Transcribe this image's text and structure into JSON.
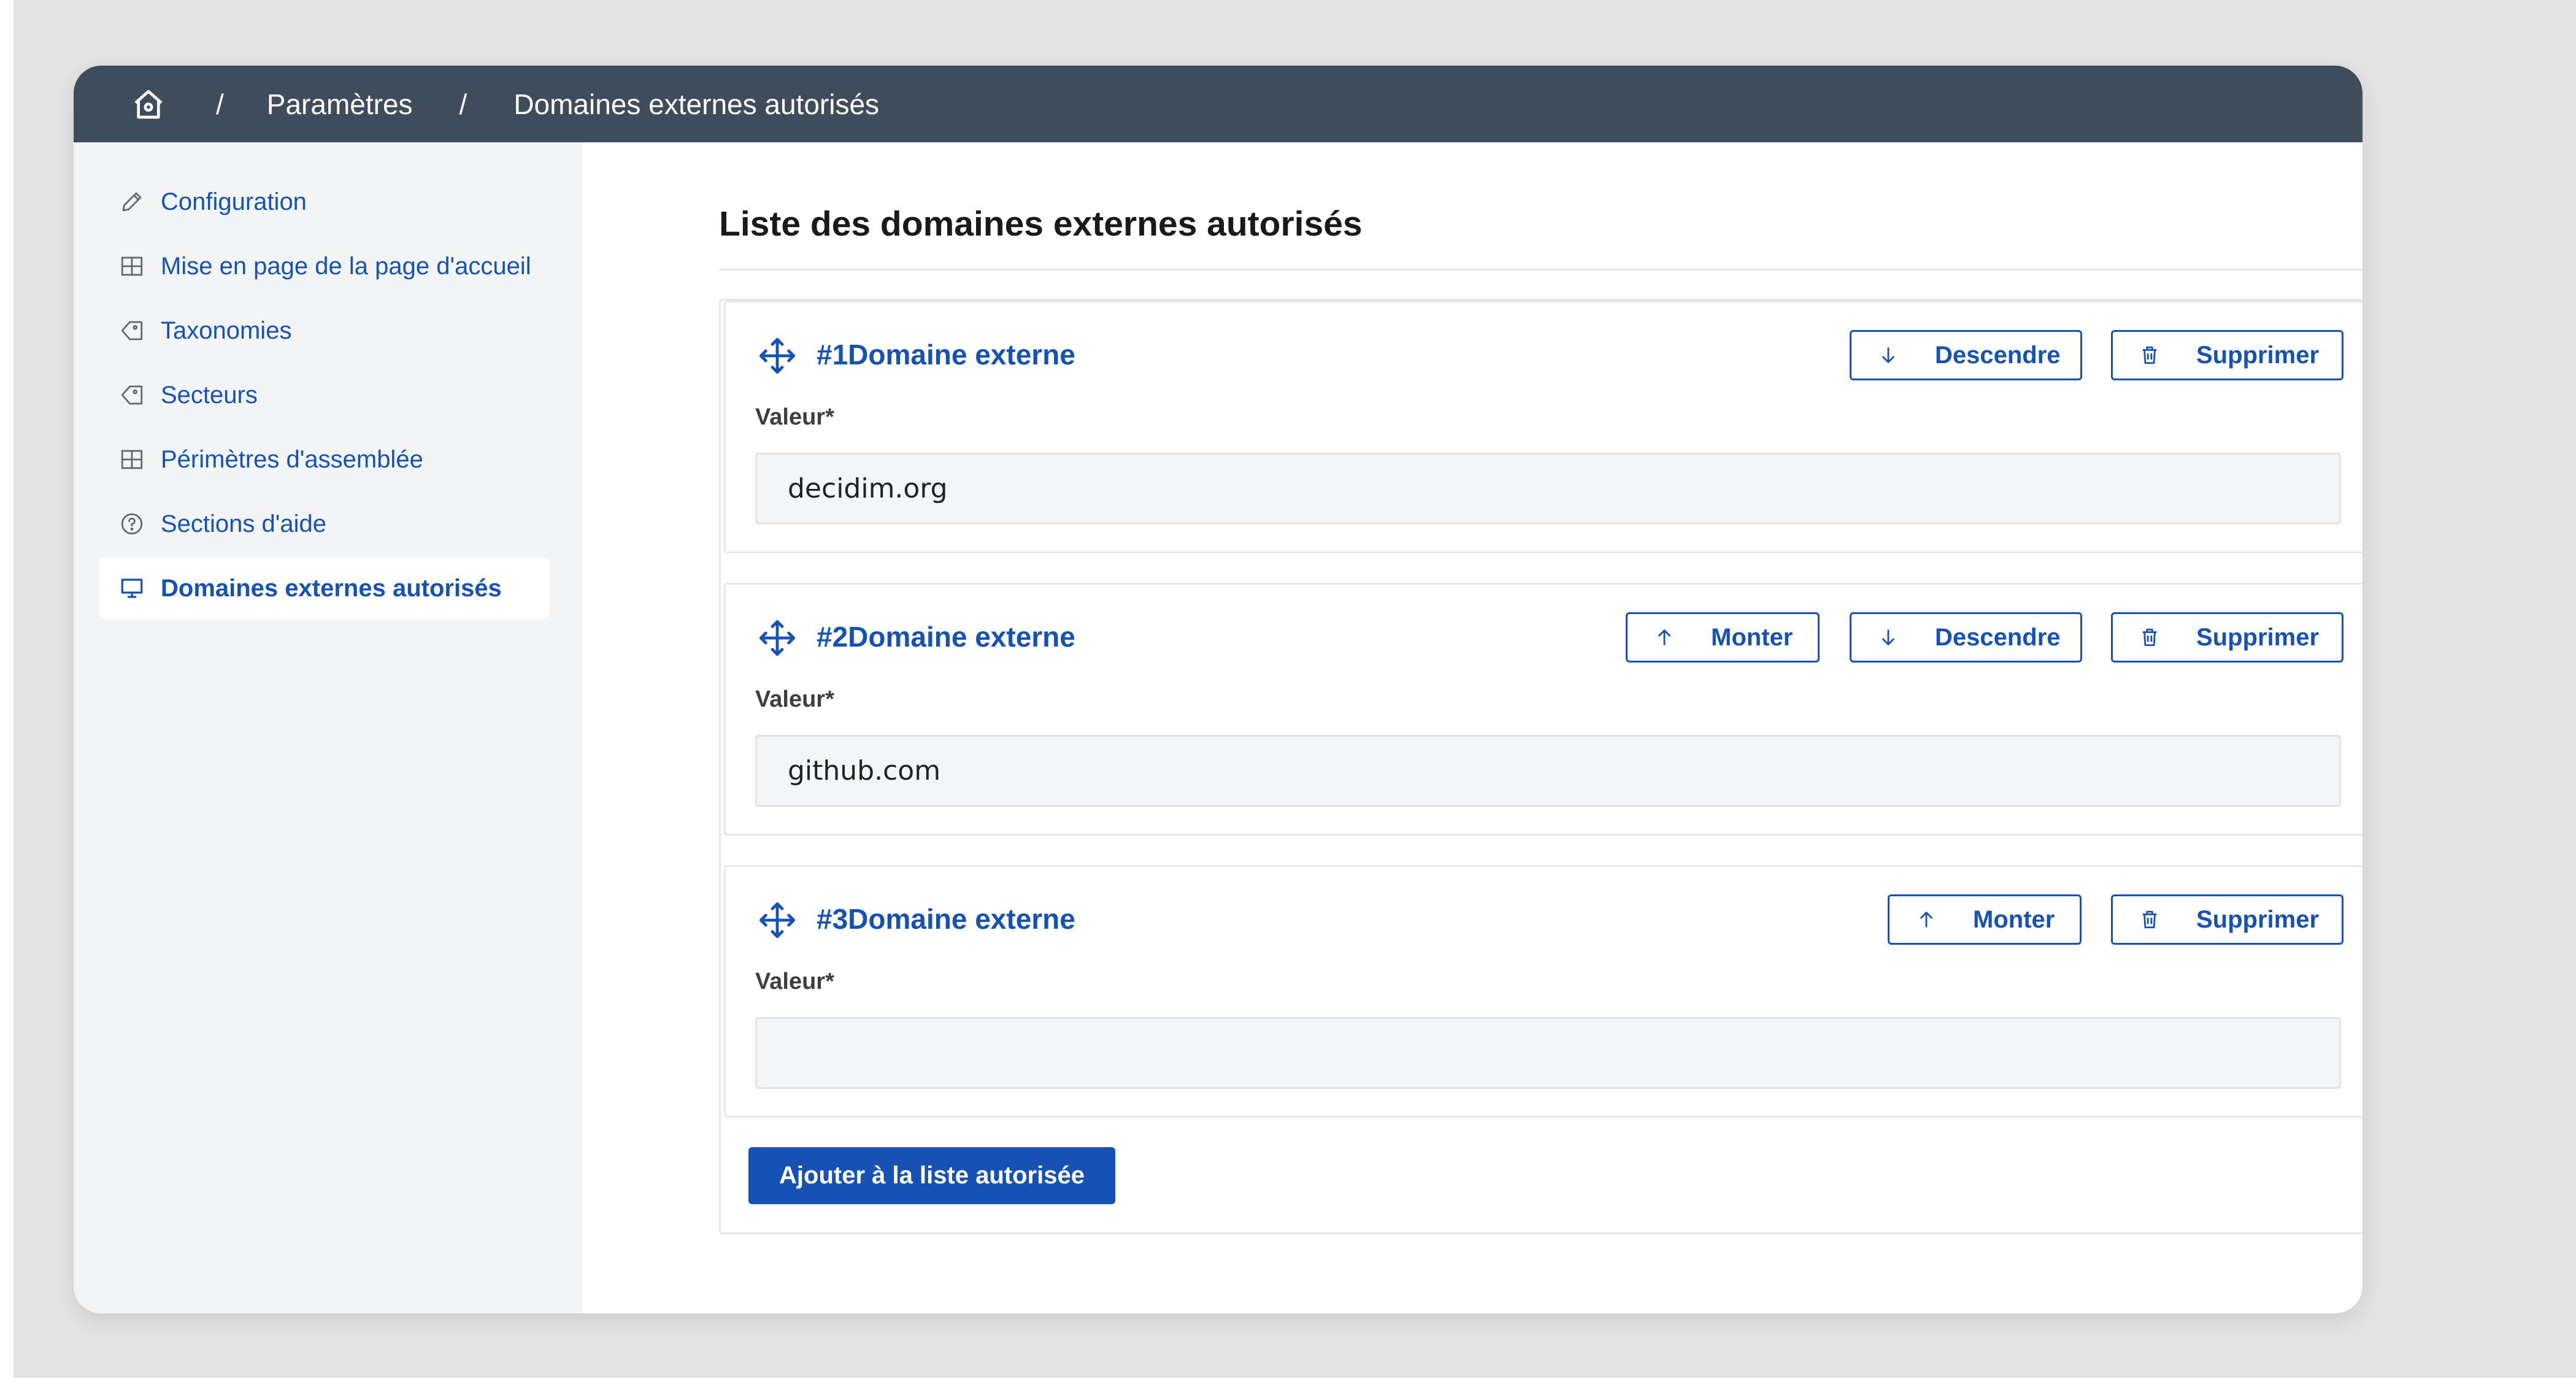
{
  "breadcrumb": {
    "home_icon": "home-icon",
    "separator": "/",
    "items": [
      "Paramètres",
      "Domaines externes autorisés"
    ]
  },
  "sidebar": {
    "items": [
      {
        "label": "Configuration",
        "icon": "pencil-icon",
        "active": false
      },
      {
        "label": "Mise en page de la page d'accueil",
        "icon": "layout-grid-icon",
        "active": false
      },
      {
        "label": "Taxonomies",
        "icon": "tag-icon",
        "active": false
      },
      {
        "label": "Secteurs",
        "icon": "tag-icon",
        "active": false
      },
      {
        "label": "Périmètres d'assemblée",
        "icon": "layout-grid-icon",
        "active": false
      },
      {
        "label": "Sections d'aide",
        "icon": "question-circle-icon",
        "active": false
      },
      {
        "label": "Domaines externes autorisés",
        "icon": "monitor-icon",
        "active": true
      }
    ]
  },
  "main": {
    "title": "Liste des domaines externes autorisés",
    "entries": [
      {
        "title": "#1Domaine externe",
        "label": "Valeur*",
        "value": "decidim.org",
        "buttons": [
          "Descendre",
          "Supprimer"
        ]
      },
      {
        "title": "#2Domaine externe",
        "label": "Valeur*",
        "value": "github.com",
        "buttons": [
          "Monter",
          "Descendre",
          "Supprimer"
        ]
      },
      {
        "title": "#3Domaine externe",
        "label": "Valeur*",
        "value": "",
        "buttons": [
          "Monter",
          "Supprimer"
        ]
      }
    ],
    "buttons": {
      "up": "Monter",
      "down": "Descendre",
      "delete": "Supprimer"
    },
    "add_button": "Ajouter à la liste autorisée"
  },
  "colors": {
    "topbar": "#3e4c5c",
    "accent": "#1652b4",
    "sidebar_bg": "#f3f4f6"
  }
}
